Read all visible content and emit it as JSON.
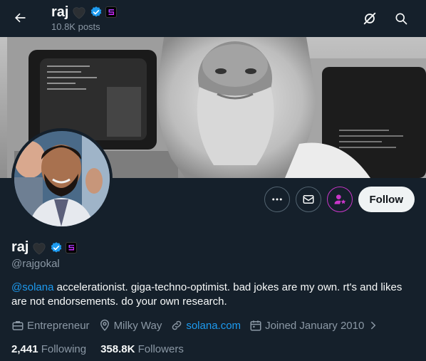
{
  "header": {
    "name": "raj",
    "posts": "10.8K posts"
  },
  "icons": {
    "back": "arrow-left-icon",
    "heart": "black-heart-icon",
    "verified": "verified-badge-icon",
    "affiliate": "solana-badge-icon",
    "notifications_off": "bell-off-icon",
    "search": "search-icon",
    "more": "more-dots-icon",
    "message": "envelope-icon",
    "subscribe": "user-star-icon"
  },
  "actions": {
    "follow_label": "Follow"
  },
  "profile": {
    "name": "raj",
    "handle": "@rajgokal",
    "bio_mention": "@solana",
    "bio_text": " accelerationist. giga-techno-optimist. bad jokes are my own. rt's and likes are not endorsements. do your own research.",
    "profession": "Entrepreneur",
    "location": "Milky Way",
    "website": "solana.com",
    "joined": "Joined January 2010"
  },
  "stats": {
    "following_count": "2,441",
    "following_label": "Following",
    "followers_count": "358.8K",
    "followers_label": "Followers"
  },
  "colors": {
    "background": "#15202b",
    "accent": "#1d9bf0",
    "muted": "#8b98a5",
    "subscribe_pink": "#c936c9"
  }
}
